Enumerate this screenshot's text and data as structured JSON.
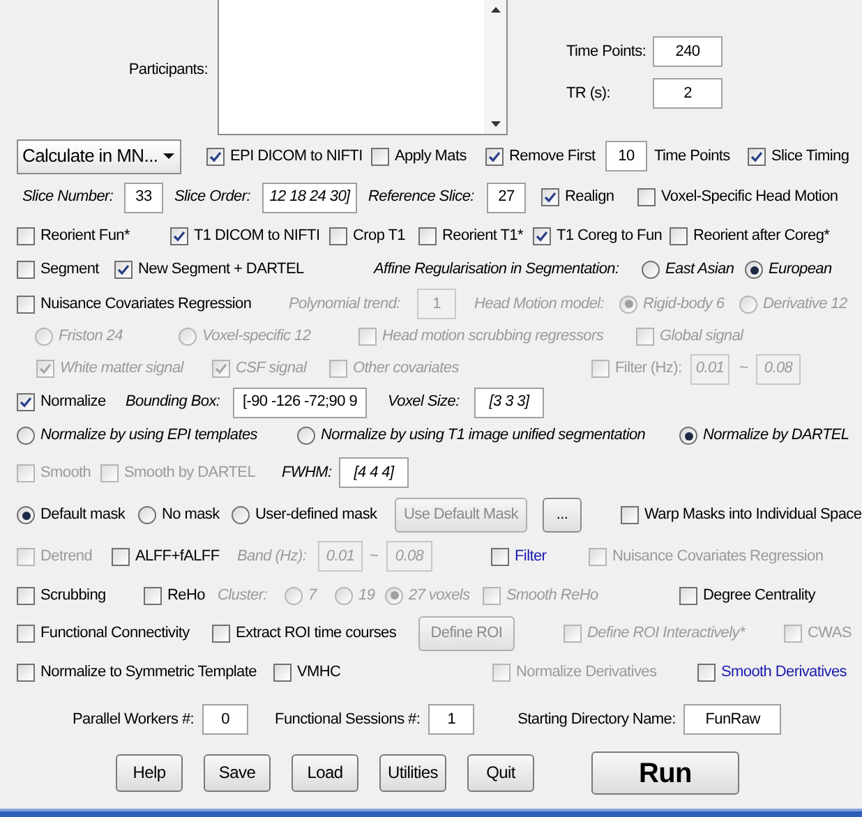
{
  "participants": {
    "label": "Participants:"
  },
  "time_points": {
    "label": "Time Points:",
    "value": "240"
  },
  "tr": {
    "label": "TR (s):",
    "value": "2"
  },
  "rows": [
    {
      "items": [
        {
          "kind": "dropdown",
          "value": "Calculate in MN..."
        },
        {
          "kind": "checkbox",
          "label": "EPI DICOM to NIFTI",
          "checked": true
        },
        {
          "kind": "checkbox",
          "label": "Apply Mats",
          "checked": false
        },
        {
          "kind": "checkbox",
          "label": "Remove First",
          "checked": true
        },
        {
          "kind": "field",
          "value": "10"
        },
        {
          "kind": "label",
          "label": "Time Points"
        },
        {
          "kind": "checkbox",
          "label": "Slice Timing",
          "checked": true
        }
      ]
    },
    {
      "items": [
        {
          "kind": "label",
          "label": "Slice Number:",
          "italic": true
        },
        {
          "kind": "field",
          "value": "33"
        },
        {
          "kind": "label",
          "label": "Slice Order:",
          "italic": true
        },
        {
          "kind": "field",
          "value": "12 18 24 30]",
          "italic": true
        },
        {
          "kind": "label",
          "label": "Reference Slice:",
          "italic": true
        },
        {
          "kind": "field",
          "value": "27"
        },
        {
          "kind": "checkbox",
          "label": "Realign",
          "checked": true
        },
        {
          "kind": "checkbox",
          "label": "Voxel-Specific Head Motion",
          "checked": false
        }
      ]
    },
    {
      "items": [
        {
          "kind": "checkbox",
          "label": "Reorient Fun*",
          "checked": false
        },
        {
          "kind": "checkbox",
          "label": "T1 DICOM to NIFTI",
          "checked": true
        },
        {
          "kind": "checkbox",
          "label": "Crop T1",
          "checked": false
        },
        {
          "kind": "checkbox",
          "label": "Reorient T1*",
          "checked": false
        },
        {
          "kind": "checkbox",
          "label": "T1 Coreg to Fun",
          "checked": true
        },
        {
          "kind": "checkbox",
          "label": "Reorient after Coreg*",
          "checked": false
        }
      ]
    },
    {
      "items": [
        {
          "kind": "checkbox",
          "label": "Segment",
          "checked": false
        },
        {
          "kind": "checkbox",
          "label": "New Segment + DARTEL",
          "checked": true
        },
        {
          "kind": "label",
          "label": "Affine Regularisation in Segmentation:",
          "italic": true
        },
        {
          "kind": "radio",
          "label": "East Asian",
          "selected": false,
          "italic": true
        },
        {
          "kind": "radio",
          "label": "European",
          "selected": true,
          "italic": true
        }
      ]
    },
    {
      "items": [
        {
          "kind": "checkbox",
          "label": "Nuisance Covariates Regression",
          "checked": false
        },
        {
          "kind": "label",
          "label": "Polynomial trend:",
          "italic": true,
          "disabled": true
        },
        {
          "kind": "field",
          "value": "1",
          "disabled": true
        },
        {
          "kind": "label",
          "label": "Head Motion model:",
          "italic": true,
          "disabled": true
        },
        {
          "kind": "radio",
          "label": "Rigid-body 6",
          "selected": true,
          "italic": true,
          "disabled": true
        },
        {
          "kind": "radio",
          "label": "Derivative 12",
          "selected": false,
          "italic": true,
          "disabled": true
        }
      ]
    },
    {
      "items": [
        {
          "kind": "radio",
          "label": "Friston 24",
          "selected": false,
          "italic": true,
          "disabled": true
        },
        {
          "kind": "radio",
          "label": "Voxel-specific 12",
          "selected": false,
          "italic": true,
          "disabled": true
        },
        {
          "kind": "checkbox",
          "label": "Head motion scrubbing regressors",
          "checked": false,
          "italic": true,
          "disabled": true
        },
        {
          "kind": "checkbox",
          "label": "Global signal",
          "checked": false,
          "italic": true,
          "disabled": true
        }
      ]
    },
    {
      "items": [
        {
          "kind": "checkbox",
          "label": "White matter signal",
          "checked": true,
          "italic": true,
          "disabled": true
        },
        {
          "kind": "checkbox",
          "label": "CSF signal",
          "checked": true,
          "italic": true,
          "disabled": true
        },
        {
          "kind": "checkbox",
          "label": "Other covariates",
          "checked": false,
          "italic": true,
          "disabled": true
        },
        {
          "kind": "checkbox",
          "label": "Filter (Hz):",
          "checked": false,
          "disabled": true
        },
        {
          "kind": "field",
          "value": "0.01",
          "italic": true,
          "disabled": true
        },
        {
          "kind": "label",
          "label": "~",
          "disabled": true
        },
        {
          "kind": "field",
          "value": "0.08",
          "italic": true,
          "disabled": true
        }
      ]
    },
    {
      "items": [
        {
          "kind": "checkbox",
          "label": "Normalize",
          "checked": true
        },
        {
          "kind": "label",
          "label": "Bounding Box:",
          "italic": true
        },
        {
          "kind": "field",
          "value": "[-90 -126 -72;90 9"
        },
        {
          "kind": "label",
          "label": "Voxel Size:",
          "italic": true
        },
        {
          "kind": "field",
          "value": "[3 3 3]",
          "italic": true
        }
      ]
    },
    {
      "items": [
        {
          "kind": "radio",
          "label": "Normalize by using EPI templates",
          "selected": false,
          "italic": true
        },
        {
          "kind": "radio",
          "label": "Normalize by using T1 image unified segmentation",
          "selected": false,
          "italic": true
        },
        {
          "kind": "radio",
          "label": "Normalize by DARTEL",
          "selected": true,
          "italic": true
        }
      ]
    },
    {
      "items": [
        {
          "kind": "checkbox",
          "label": "Smooth",
          "checked": false,
          "disabled": true
        },
        {
          "kind": "checkbox",
          "label": "Smooth by DARTEL",
          "checked": false,
          "disabled": true
        },
        {
          "kind": "label",
          "label": "FWHM:",
          "italic": true
        },
        {
          "kind": "field",
          "value": "[4 4 4]",
          "italic": true
        }
      ]
    },
    {
      "items": [
        {
          "kind": "radio",
          "label": "Default mask",
          "selected": true
        },
        {
          "kind": "radio",
          "label": "No mask",
          "selected": false
        },
        {
          "kind": "radio",
          "label": "User-defined mask",
          "selected": false
        },
        {
          "kind": "button",
          "label": "Use Default Mask",
          "disabled": true
        },
        {
          "kind": "button",
          "label": "...",
          "disabled": false
        },
        {
          "kind": "checkbox",
          "label": "Warp Masks into Individual Space",
          "checked": false
        }
      ]
    },
    {
      "items": [
        {
          "kind": "checkbox",
          "label": "Detrend",
          "checked": false,
          "disabled": true
        },
        {
          "kind": "checkbox",
          "label": "ALFF+fALFF",
          "checked": false
        },
        {
          "kind": "label",
          "label": "Band (Hz):",
          "italic": true,
          "disabled": true
        },
        {
          "kind": "field",
          "value": "0.01",
          "italic": true,
          "disabled": true
        },
        {
          "kind": "label",
          "label": "~",
          "disabled": true
        },
        {
          "kind": "field",
          "value": "0.08",
          "italic": true,
          "disabled": true
        },
        {
          "kind": "checkbox",
          "label": "Filter",
          "checked": false,
          "highlighted": true
        },
        {
          "kind": "checkbox",
          "label": "Nuisance Covariates Regression",
          "checked": false,
          "disabled": true
        }
      ]
    },
    {
      "items": [
        {
          "kind": "checkbox",
          "label": "Scrubbing",
          "checked": false
        },
        {
          "kind": "checkbox",
          "label": "ReHo",
          "checked": false
        },
        {
          "kind": "label",
          "label": "Cluster:",
          "italic": true,
          "disabled": true
        },
        {
          "kind": "radio",
          "label": "7",
          "selected": false,
          "italic": true,
          "disabled": true
        },
        {
          "kind": "radio",
          "label": "19",
          "selected": false,
          "italic": true,
          "disabled": true
        },
        {
          "kind": "radio",
          "label": "27 voxels",
          "selected": true,
          "italic": true,
          "disabled": true
        },
        {
          "kind": "checkbox",
          "label": "Smooth ReHo",
          "checked": false,
          "italic": true,
          "disabled": true
        },
        {
          "kind": "checkbox",
          "label": "Degree Centrality",
          "checked": false
        }
      ]
    },
    {
      "items": [
        {
          "kind": "checkbox",
          "label": "Functional Connectivity",
          "checked": false
        },
        {
          "kind": "checkbox",
          "label": "Extract ROI time courses",
          "checked": false
        },
        {
          "kind": "button",
          "label": "Define ROI",
          "disabled": true
        },
        {
          "kind": "checkbox",
          "label": "Define ROI Interactively*",
          "checked": false,
          "italic": true,
          "disabled": true
        },
        {
          "kind": "checkbox",
          "label": "CWAS",
          "checked": false,
          "disabled": true
        }
      ]
    },
    {
      "items": [
        {
          "kind": "checkbox",
          "label": "Normalize to Symmetric Template",
          "checked": false
        },
        {
          "kind": "checkbox",
          "label": "VMHC",
          "checked": false
        },
        {
          "kind": "checkbox",
          "label": "Normalize Derivatives",
          "checked": false,
          "disabled": true
        },
        {
          "kind": "checkbox",
          "label": "Smooth Derivatives",
          "checked": false,
          "highlighted": true
        }
      ]
    }
  ],
  "settings": [
    {
      "label": "Parallel Workers #:",
      "value": "0"
    },
    {
      "label": "Functional Sessions #:",
      "value": "1"
    },
    {
      "label": "Starting Directory Name:",
      "value": "FunRaw"
    }
  ],
  "buttons": [
    {
      "label": "Help",
      "kind": "small"
    },
    {
      "label": "Save",
      "kind": "small"
    },
    {
      "label": "Load",
      "kind": "small"
    },
    {
      "label": "Utilities",
      "kind": "small"
    },
    {
      "label": "Quit",
      "kind": "small"
    },
    {
      "label": "Run",
      "kind": "primary"
    }
  ]
}
